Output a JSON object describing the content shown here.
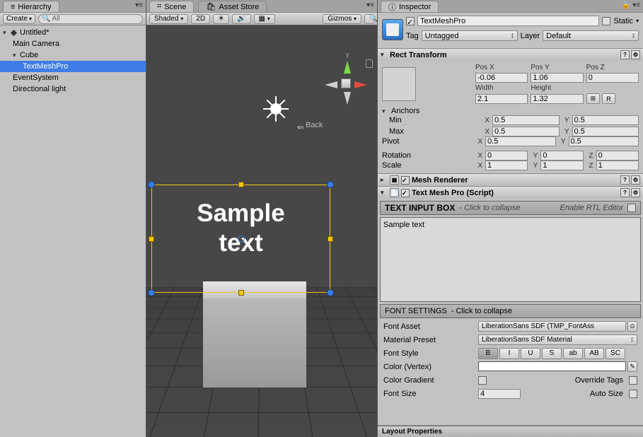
{
  "hierarchy": {
    "tab": "Hierarchy",
    "create": "Create",
    "search_placeholder": "All",
    "root": "Untitled*",
    "items": [
      "Main Camera",
      "Cube",
      "TextMeshPro",
      "EventSystem",
      "Directional light"
    ]
  },
  "scene": {
    "tab_scene": "Scene",
    "tab_asset": "Asset Store",
    "shading": "Shaded",
    "mode_2d": "2D",
    "gizmos": "Gizmos",
    "back": "Back",
    "sample": "Sample text",
    "persp": ""
  },
  "inspector": {
    "tab": "Inspector",
    "go_name": "TextMeshPro",
    "static": "Static",
    "tag_label": "Tag",
    "tag_value": "Untagged",
    "layer_label": "Layer",
    "layer_value": "Default",
    "rect": {
      "title": "Rect Transform",
      "posx_l": "Pos X",
      "posy_l": "Pos Y",
      "posz_l": "Pos Z",
      "posx": "-0.06",
      "posy": "1.06",
      "posz": "0",
      "width_l": "Width",
      "height_l": "Height",
      "width": "2.1",
      "height": "1.32",
      "anchors": "Anchors",
      "min": "Min",
      "max": "Max",
      "pivot": "Pivot",
      "minx": "0.5",
      "miny": "0.5",
      "maxx": "0.5",
      "maxy": "0.5",
      "pivx": "0.5",
      "pivy": "0.5",
      "rotation": "Rotation",
      "scale": "Scale",
      "rx": "0",
      "ry": "0",
      "rz": "0",
      "sx": "1",
      "sy": "1",
      "sz": "1",
      "r_btn": "R"
    },
    "mesh_renderer": "Mesh Renderer",
    "tmp_title": "Text Mesh Pro (Script)",
    "text_input": {
      "title": "TEXT INPUT BOX",
      "hint": "- Click to collapse",
      "rtl": "Enable RTL Editor",
      "value": "Sample text"
    },
    "font": {
      "title": "FONT SETTINGS",
      "hint": "- Click to collapse",
      "asset_l": "Font Asset",
      "asset": "LiberationSans SDF (TMP_FontAss",
      "preset_l": "Material Preset",
      "preset": "LiberationSans SDF Material",
      "style_l": "Font Style",
      "styles": [
        "B",
        "I",
        "U",
        "S",
        "ab",
        "AB",
        "SC"
      ],
      "color_l": "Color (Vertex)",
      "grad_l": "Color Gradient",
      "override": "Override Tags",
      "size_l": "Font Size",
      "size": "4",
      "auto": "Auto Size"
    }
  },
  "footer": "Layout Properties"
}
